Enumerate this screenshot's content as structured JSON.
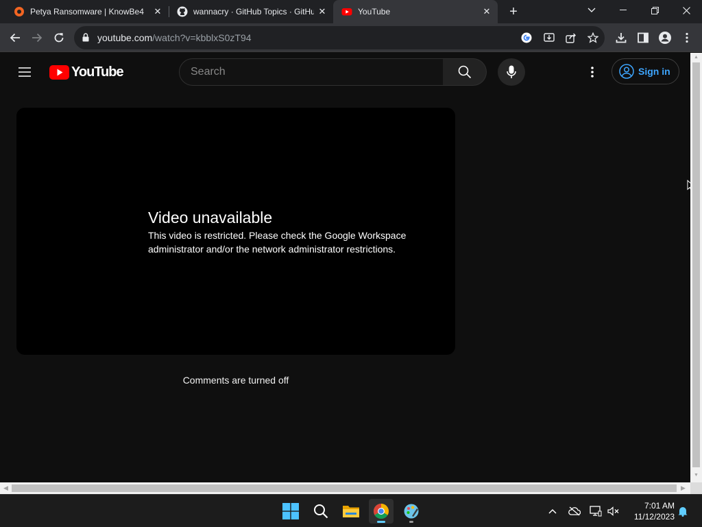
{
  "browser": {
    "tabs": [
      {
        "title": "Petya Ransomware | KnowBe4",
        "icon": "knowbe4-favicon"
      },
      {
        "title": "wannacry · GitHub Topics · GitHub",
        "icon": "github-favicon"
      },
      {
        "title": "YouTube",
        "icon": "youtube-favicon",
        "active": true
      }
    ],
    "url_host": "youtube.com",
    "url_path": "/watch?v=kbblxS0zT94"
  },
  "youtube": {
    "logo_text": "YouTube",
    "search_placeholder": "Search",
    "signin_label": "Sign in",
    "error_title": "Video unavailable",
    "error_message": "This video is restricted. Please check the Google Workspace administrator and/or the network administrator restrictions.",
    "comments_status": "Comments are turned off"
  },
  "taskbar": {
    "time": "7:01 AM",
    "date": "11/12/2023"
  },
  "colors": {
    "youtube_red": "#ff0000",
    "link_blue": "#3ea6ff",
    "page_bg": "#0f0f0f",
    "accent": "#60cdff"
  }
}
